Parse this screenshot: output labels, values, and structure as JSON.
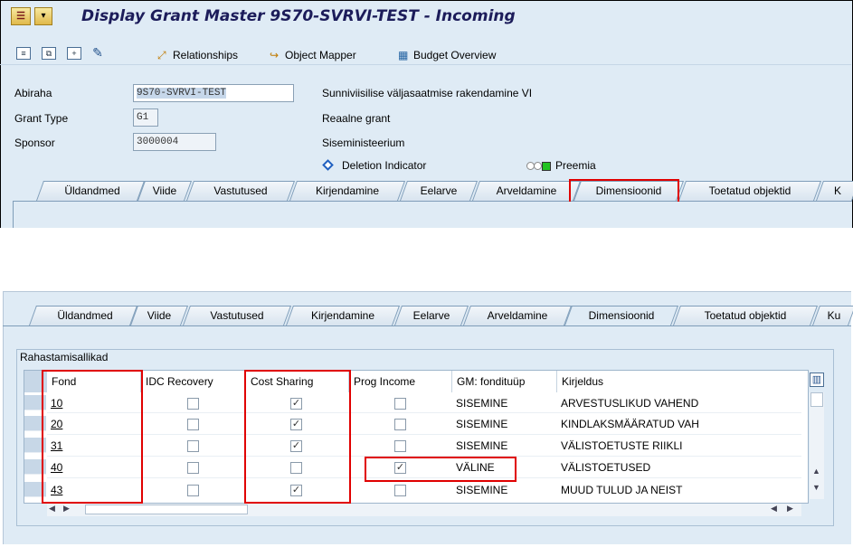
{
  "window": {
    "title": "Display Grant Master 9S70-SVRVI-TEST - Incoming"
  },
  "toolbar": {
    "relationships": "Relationships",
    "object_mapper": "Object Mapper",
    "budget_overview": "Budget Overview"
  },
  "header_fields": [
    {
      "label": "Abiraha",
      "value": "9S70-SVRVI-TEST",
      "description": "Sunniviisilise väljasaatmise rakendamine VI"
    },
    {
      "label": "Grant Type",
      "value": "G1",
      "description": "Reaalne grant"
    },
    {
      "label": "Sponsor",
      "value": "3000004",
      "description": "Siseministeerium"
    }
  ],
  "deletion_indicator": "Deletion Indicator",
  "status": "Preemia",
  "tabs": [
    "Üldandmed",
    "Viide",
    "Vastutused",
    "Kirjendamine",
    "Eelarve",
    "Arveldamine",
    "Dimensioonid",
    "Toetatud objektid"
  ],
  "tabs_bottom": [
    "Üldandmed",
    "Viide",
    "Vastutused",
    "Kirjendamine",
    "Eelarve",
    "Arveldamine",
    "Dimensioonid",
    "Toetatud objektid",
    "Ku"
  ],
  "tab_overflow_top": "K",
  "active_tab": "Dimensioonid",
  "group_title": "Rahastamisallikad",
  "table": {
    "columns": [
      "Fond",
      "IDC Recovery",
      "Cost Sharing",
      "Prog Income",
      "GM: fondituüp",
      "Kirjeldus"
    ],
    "rows": [
      {
        "fond": "10",
        "idc": false,
        "cost_sharing": true,
        "prog_income": false,
        "type": "SISEMINE",
        "desc": "ARVESTUSLIKUD VAHEND"
      },
      {
        "fond": "20",
        "idc": false,
        "cost_sharing": true,
        "prog_income": false,
        "type": "SISEMINE",
        "desc": "KINDLAKSMÄÄRATUD VAH"
      },
      {
        "fond": "31",
        "idc": false,
        "cost_sharing": true,
        "prog_income": false,
        "type": "SISEMINE",
        "desc": "VÄLISTOETUSTE RIIKLI"
      },
      {
        "fond": "40",
        "idc": false,
        "cost_sharing": false,
        "prog_income": true,
        "type": "VÄLINE",
        "desc": "VÄLISTOETUSED"
      },
      {
        "fond": "43",
        "idc": false,
        "cost_sharing": true,
        "prog_income": false,
        "type": "SISEMINE",
        "desc": "MUUD TULUD JA NEIST"
      }
    ]
  },
  "colors": {
    "background": "#dfebf5",
    "highlight": "#e00000",
    "status_on": "#22c322"
  }
}
